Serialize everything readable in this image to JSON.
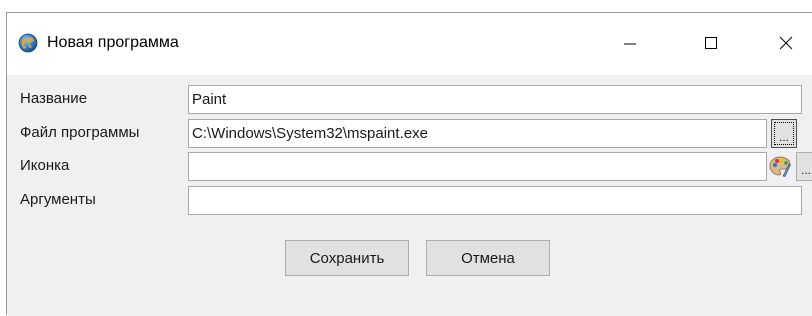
{
  "window": {
    "title": "Новая программа",
    "app_icon": "globe-icon",
    "caption_icons": [
      "minimize-icon",
      "maximize-icon",
      "close-icon"
    ]
  },
  "form": {
    "name": {
      "label": "Название",
      "value": "Paint"
    },
    "file": {
      "label": "Файл программы",
      "value": "C:\\Windows\\System32\\mspaint.exe",
      "browse_label": "..."
    },
    "icon": {
      "label": "Иконка",
      "value": "",
      "preview_icon": "paint-palette-icon",
      "browse_label": "..."
    },
    "args": {
      "label": "Аргументы",
      "value": ""
    }
  },
  "buttons": {
    "save": "Сохранить",
    "cancel": "Отмена"
  },
  "colors": {
    "client_background": "#f0f0f0",
    "button_face": "#e1e1e1",
    "border": "#a9a9a9"
  }
}
